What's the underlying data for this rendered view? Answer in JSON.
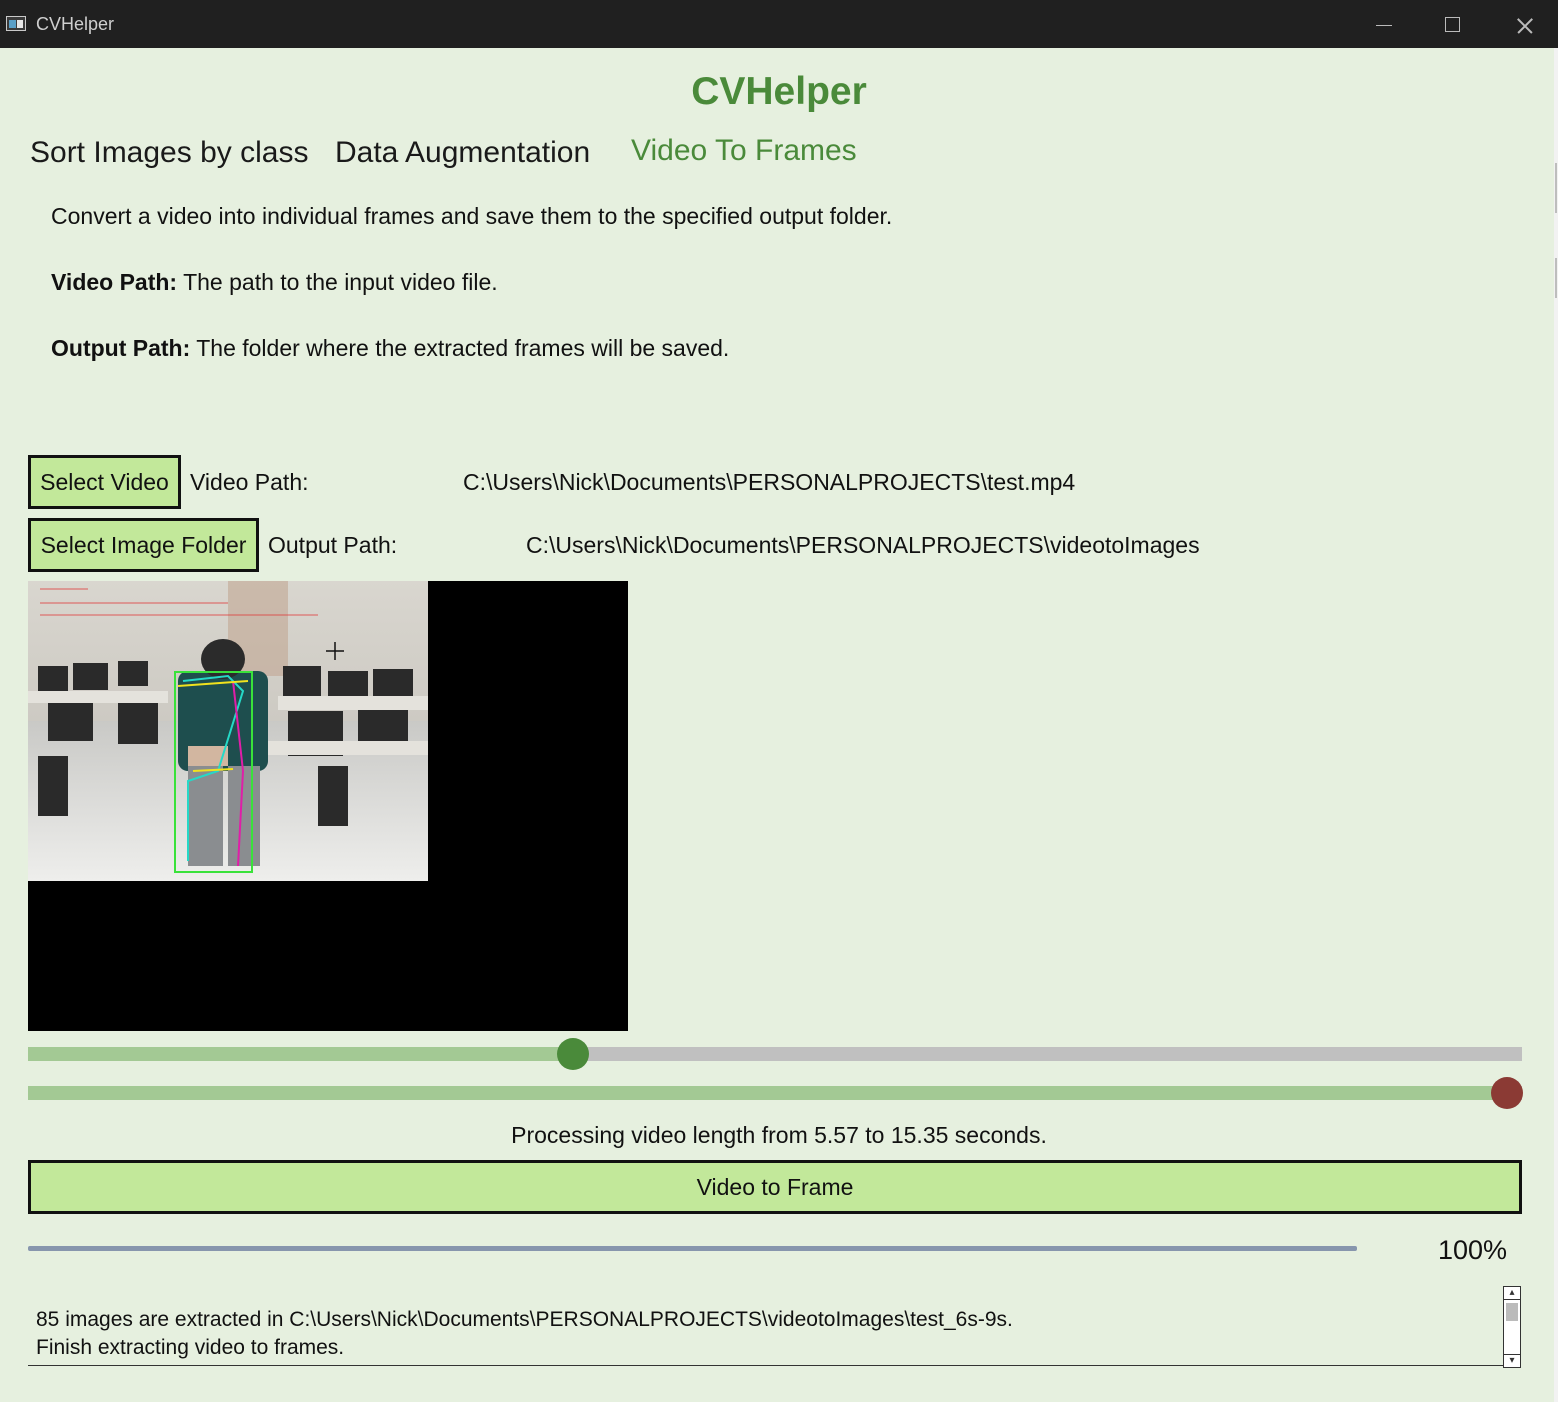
{
  "window": {
    "title": "CVHelper"
  },
  "app": {
    "heading": "CVHelper"
  },
  "tabs": [
    {
      "label": "Sort Images by class",
      "active": false
    },
    {
      "label": "Data Augmentation",
      "active": false
    },
    {
      "label": "Video To Frames",
      "active": true
    }
  ],
  "description": {
    "intro": "Convert a video into individual frames and save them to the specified output folder.",
    "video_path_term": "Video Path:",
    "video_path_text": " The path to the input video file.",
    "output_path_term": "Output Path:",
    "output_path_text": " The folder where the extracted frames will be saved."
  },
  "video_select": {
    "button_label": "Select Video",
    "field_label": "Video Path:",
    "value": "C:\\Users\\Nick\\Documents\\PERSONALPROJECTS\\test.mp4"
  },
  "output_select": {
    "button_label": "Select Image Folder",
    "field_label": "Output Path:",
    "value": "C:\\Users\\Nick\\Documents\\PERSONALPROJECTS\\videotoImages"
  },
  "sliders": {
    "start": {
      "fraction": 0.365,
      "thumb_color": "#4a8a3a"
    },
    "end": {
      "fraction": 0.99,
      "thumb_color": "#8b3a34"
    }
  },
  "status": {
    "message": "Processing video length from 5.57 to 15.35 seconds."
  },
  "convert_button": {
    "label": "Video to Frame"
  },
  "progress": {
    "percent": 100,
    "label": "100%"
  },
  "log": {
    "lines": [
      "85 images are extracted in C:\\Users\\Nick\\Documents\\PERSONALPROJECTS\\videotoImages\\test_6s-9s.",
      "Finish extracting video to frames."
    ]
  },
  "colors": {
    "accent": "#4a8a3a",
    "button_bg": "#c2e89a",
    "window_bg": "#e6f0df"
  }
}
